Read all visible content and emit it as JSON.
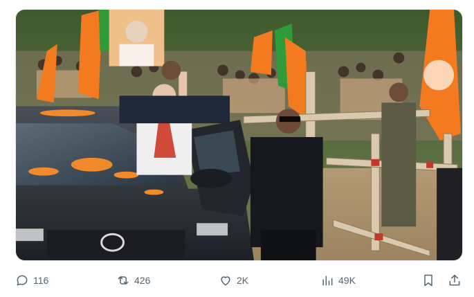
{
  "media": {
    "kind": "photo",
    "accent_saffron": "#f47a1f",
    "accent_green": "#2e9a3a"
  },
  "actions": {
    "reply": {
      "icon": "reply-icon",
      "count": "116"
    },
    "repost": {
      "icon": "repost-icon",
      "count": "426"
    },
    "like": {
      "icon": "heart-icon",
      "count": "2K"
    },
    "views": {
      "icon": "analytics-icon",
      "count": "49K"
    },
    "bookmark": {
      "icon": "bookmark-icon"
    },
    "share": {
      "icon": "share-icon"
    }
  }
}
